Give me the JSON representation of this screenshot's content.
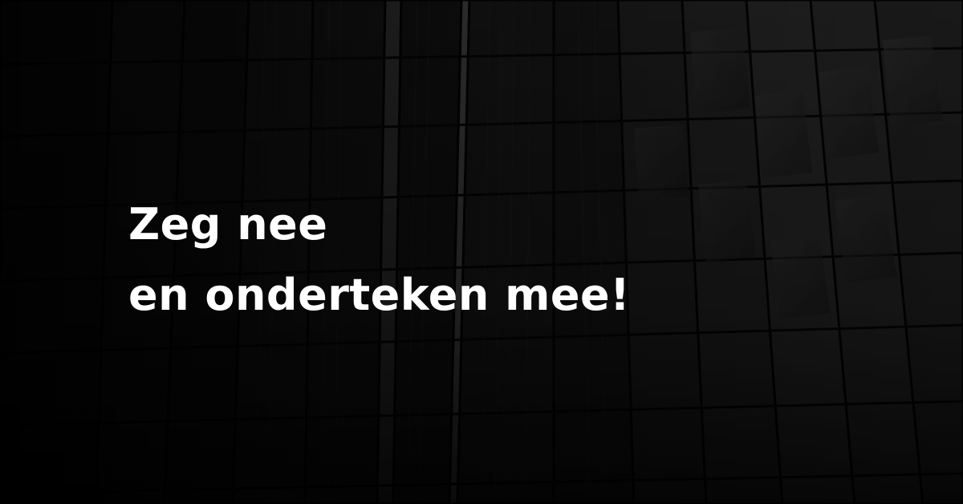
{
  "headline": {
    "line1": "Zeg nee",
    "line2": "en onderteken mee!"
  },
  "background": {
    "subject": "dark building facade",
    "colors": {
      "base": "#0d0d0d",
      "panel": "#1e1e1e",
      "highlight": "#3a3a3a",
      "text": "#ffffff"
    }
  }
}
